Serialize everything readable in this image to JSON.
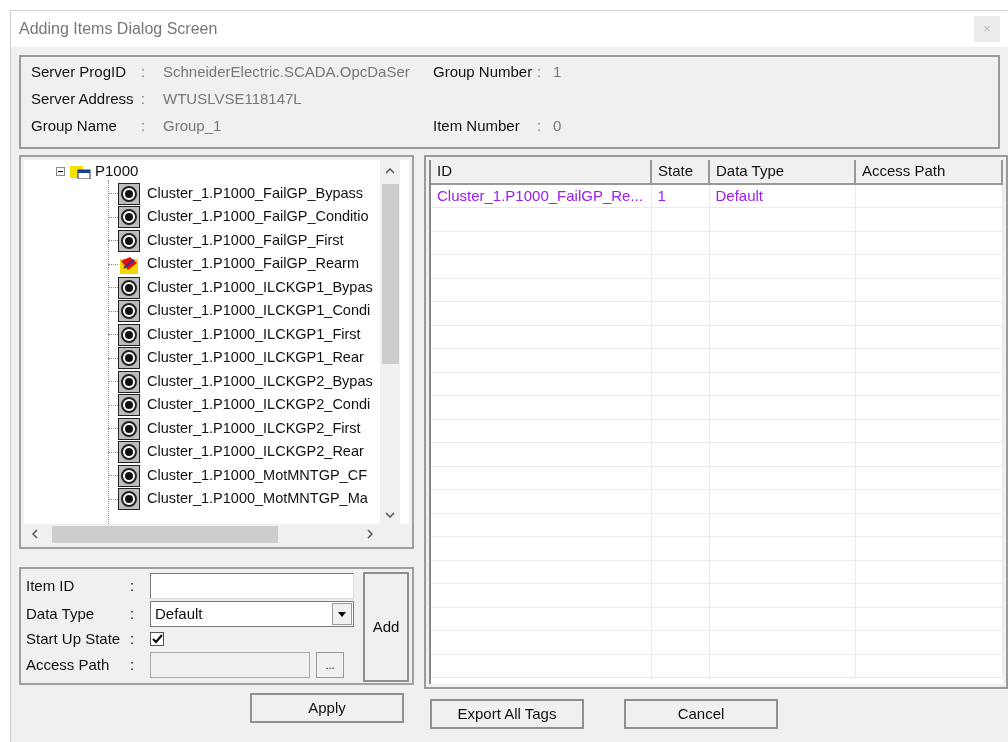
{
  "window": {
    "title": "Adding Items Dialog Screen",
    "close": "×"
  },
  "info": {
    "fields": [
      {
        "label": "Server ProgID",
        "sep": ":",
        "value": "SchneiderElectric.SCADA.OpcDaSer"
      },
      {
        "label": "Server Address",
        "sep": ":",
        "value": "WTUSLVSE118147L"
      },
      {
        "label": "Group Name",
        "sep": ":",
        "value": "Group_1"
      }
    ],
    "side_fields": [
      {
        "label": "Group Number",
        "sep": ":",
        "value": "1"
      },
      {
        "label": "Item Number",
        "sep": ":",
        "value": "0"
      }
    ]
  },
  "tree": {
    "root": {
      "label": "P1000",
      "expanded": true,
      "children": [
        {
          "kind": "tag",
          "label": "Cluster_1.P1000_FailGP_Bypass"
        },
        {
          "kind": "tag",
          "label": "Cluster_1.P1000_FailGP_Conditio"
        },
        {
          "kind": "tag",
          "label": "Cluster_1.P1000_FailGP_First"
        },
        {
          "kind": "alert",
          "label": "Cluster_1.P1000_FailGP_Rearm"
        },
        {
          "kind": "tag",
          "label": "Cluster_1.P1000_ILCKGP1_Bypas"
        },
        {
          "kind": "tag",
          "label": "Cluster_1.P1000_ILCKGP1_Condi"
        },
        {
          "kind": "tag",
          "label": "Cluster_1.P1000_ILCKGP1_First"
        },
        {
          "kind": "tag",
          "label": "Cluster_1.P1000_ILCKGP1_Rear"
        },
        {
          "kind": "tag",
          "label": "Cluster_1.P1000_ILCKGP2_Bypas"
        },
        {
          "kind": "tag",
          "label": "Cluster_1.P1000_ILCKGP2_Condi"
        },
        {
          "kind": "tag",
          "label": "Cluster_1.P1000_ILCKGP2_First"
        },
        {
          "kind": "tag",
          "label": "Cluster_1.P1000_ILCKGP2_Rear"
        },
        {
          "kind": "tag",
          "label": "Cluster_1.P1000_MotMNTGP_CF"
        },
        {
          "kind": "tag",
          "label": "Cluster_1.P1000_MotMNTGP_Ma"
        }
      ]
    }
  },
  "form": {
    "item_id": {
      "label": "Item ID",
      "sep": ":"
    },
    "data_type": {
      "label": "Data Type",
      "sep": ":",
      "value": "Default"
    },
    "start_up_state": {
      "label": "Start Up State",
      "sep": ":",
      "checked": true
    },
    "access_path": {
      "label": "Access Path",
      "sep": ":",
      "disabled": true,
      "browse": "..."
    },
    "add": "Add"
  },
  "table": {
    "columns": [
      "ID",
      "State",
      "Data Type",
      "Access Path"
    ],
    "rows": [
      [
        "Cluster_1.P1000_FailGP_Re...",
        "1",
        "Default"
      ]
    ]
  },
  "buttons": [
    "Apply",
    "Export All Tags",
    "Cancel"
  ]
}
